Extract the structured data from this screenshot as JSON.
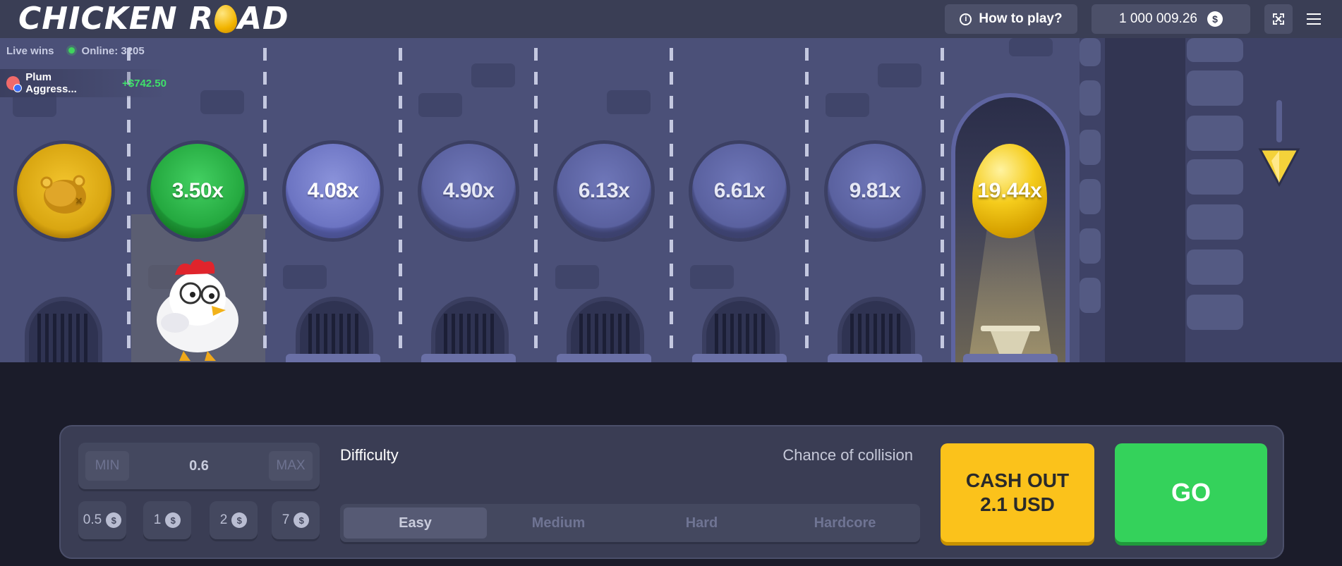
{
  "header": {
    "logo_left": "CHICKEN R",
    "logo_right": "AD",
    "how_to_play": "How to play?",
    "info_glyph": "i",
    "balance": "1 000 009.26",
    "currency_glyph": "$"
  },
  "live": {
    "label": "Live wins",
    "online": "Online: 3205",
    "win": {
      "name": "Plum Aggress...",
      "amount": "+$742.50"
    }
  },
  "lanes": {
    "multipliers": [
      "3.50x",
      "4.08x",
      "4.90x",
      "6.13x",
      "6.61x",
      "9.81x"
    ],
    "final": "19.44x",
    "current_lane": 1
  },
  "controls": {
    "min": "MIN",
    "bet": "0.6",
    "max": "MAX",
    "chips": [
      "0.5",
      "1",
      "2",
      "7"
    ],
    "chip_currency": "$",
    "difficulty_label": "Difficulty",
    "chance_label": "Chance of collision",
    "difficulties": [
      "Easy",
      "Medium",
      "Hard",
      "Hardcore"
    ],
    "active_difficulty": "Easy",
    "cashout_line1": "CASH OUT",
    "cashout_line2": "2.1 USD",
    "go": "GO"
  },
  "colors": {
    "accent_yellow": "#fbc21b",
    "accent_green": "#34d25b"
  }
}
